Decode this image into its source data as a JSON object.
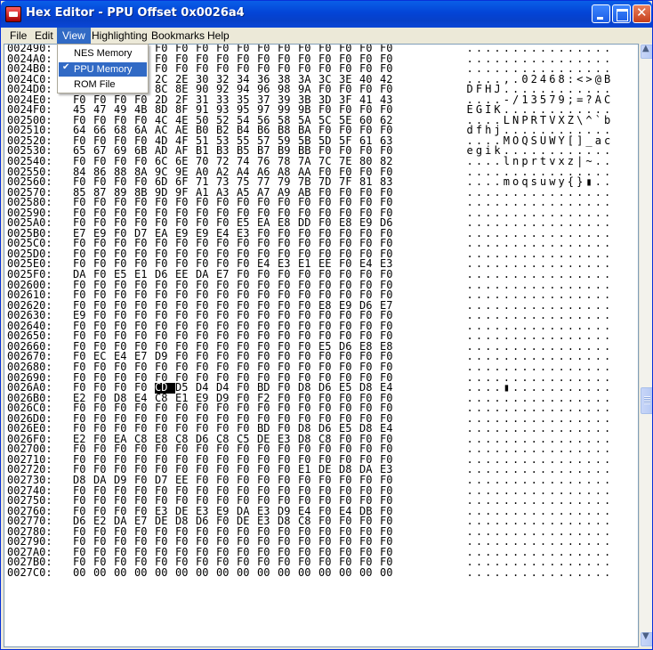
{
  "window": {
    "title": "Hex Editor - PPU Offset 0x0026a4"
  },
  "menubar": {
    "items": [
      "File",
      "Edit",
      "View",
      "Highlighting",
      "Bookmarks",
      "Help"
    ],
    "active": "View"
  },
  "view_menu": {
    "items": [
      {
        "label": "NES Memory"
      },
      {
        "label": "PPU Memory",
        "checked": true
      },
      {
        "label": "ROM File"
      }
    ]
  },
  "hex": {
    "cursor_offset": "0026A4",
    "rows": [
      {
        "address": "002490",
        "bytes": "F0 F0 F0 F0 F0 F0 F0 F0 F0 F0 F0 F0 F0 F0 F0 F0",
        "ascii": "................"
      },
      {
        "address": "0024A0",
        "bytes": "F0 F0 F0 F0 F0 F0 F0 F0 F0 F0 F0 F0 F0 F0 F0 F0",
        "ascii": "................"
      },
      {
        "address": "0024B0",
        "bytes": "F0 F0 F0 F0 F0 F0 F0 F0 F0 F0 F0 F0 F0 F0 F0 F0",
        "ascii": "................"
      },
      {
        "address": "0024C0",
        "bytes": "F0 F0 F0 F0 2C 2E 30 32 34 36 38 3A 3C 3E 40 42",
        "ascii": "....,.02468:<>@B"
      },
      {
        "address": "0024D0",
        "bytes": "44 46 48 4A 8C 8E 90 92 94 96 98 9A F0 F0 F0 F0",
        "ascii": "DFHJ............"
      },
      {
        "address": "0024E0",
        "bytes": "F0 F0 F0 F0 2D 2F 31 33 35 37 39 3B 3D 3F 41 43",
        "ascii": "....-/13579;=?AC"
      },
      {
        "address": "0024F0",
        "bytes": "45 47 49 4B 8D 8F 91 93 95 97 99 9B F0 F0 F0 F0",
        "ascii": "EGIK............"
      },
      {
        "address": "002500",
        "bytes": "F0 F0 F0 F0 4C 4E 50 52 54 56 58 5A 5C 5E 60 62",
        "ascii": "....LNPRTVXZ\\^`b"
      },
      {
        "address": "002510",
        "bytes": "64 66 68 6A AC AE B0 B2 B4 B6 B8 BA F0 F0 F0 F0",
        "ascii": "dfhj............"
      },
      {
        "address": "002520",
        "bytes": "F0 F0 F0 F0 4D 4F 51 53 55 57 59 5B 5D 5F 61 63",
        "ascii": "....MOQSUWY[]_ac"
      },
      {
        "address": "002530",
        "bytes": "65 67 69 6B AD AF B1 B3 B5 B7 B9 BB F0 F0 F0 F0",
        "ascii": "egik............"
      },
      {
        "address": "002540",
        "bytes": "F0 F0 F0 F0 6C 6E 70 72 74 76 78 7A 7C 7E 80 82",
        "ascii": "....lnprtvxz|~.."
      },
      {
        "address": "002550",
        "bytes": "84 86 88 8A 9C 9E A0 A2 A4 A6 A8 AA F0 F0 F0 F0",
        "ascii": "................"
      },
      {
        "address": "002560",
        "bytes": "F0 F0 F0 F0 6D 6F 71 73 75 77 79 7B 7D 7F 81 83",
        "ascii": "....moqsuwy{}▮.."
      },
      {
        "address": "002570",
        "bytes": "85 87 89 8B 9D 9F A1 A3 A5 A7 A9 AB F0 F0 F0 F0",
        "ascii": "................"
      },
      {
        "address": "002580",
        "bytes": "F0 F0 F0 F0 F0 F0 F0 F0 F0 F0 F0 F0 F0 F0 F0 F0",
        "ascii": "................"
      },
      {
        "address": "002590",
        "bytes": "F0 F0 F0 F0 F0 F0 F0 F0 F0 F0 F0 F0 F0 F0 F0 F0",
        "ascii": "................"
      },
      {
        "address": "0025A0",
        "bytes": "F0 F0 F0 F0 F0 F0 F0 F0 E5 EA E8 DD F0 E8 E9 D6",
        "ascii": "................"
      },
      {
        "address": "0025B0",
        "bytes": "E7 E9 F0 D7 EA E9 E9 E4 E3 F0 F0 F0 F0 F0 F0 F0",
        "ascii": "................"
      },
      {
        "address": "0025C0",
        "bytes": "F0 F0 F0 F0 F0 F0 F0 F0 F0 F0 F0 F0 F0 F0 F0 F0",
        "ascii": "................"
      },
      {
        "address": "0025D0",
        "bytes": "F0 F0 F0 F0 F0 F0 F0 F0 F0 F0 F0 F0 F0 F0 F0 F0",
        "ascii": "................"
      },
      {
        "address": "0025E0",
        "bytes": "F0 F0 F0 F0 F0 F0 F0 F0 F0 E4 E3 E1 EE F0 E4 E3",
        "ascii": "................"
      },
      {
        "address": "0025F0",
        "bytes": "DA F0 E5 E1 D6 EE DA E7 F0 F0 F0 F0 F0 F0 F0 F0",
        "ascii": "................"
      },
      {
        "address": "002600",
        "bytes": "F0 F0 F0 F0 F0 F0 F0 F0 F0 F0 F0 F0 F0 F0 F0 F0",
        "ascii": "................"
      },
      {
        "address": "002610",
        "bytes": "F0 F0 F0 F0 F0 F0 F0 F0 F0 F0 F0 F0 F0 F0 F0 F0",
        "ascii": "................"
      },
      {
        "address": "002620",
        "bytes": "F0 F0 F0 F0 F0 F0 F0 F0 F0 F0 F0 F0 E8 E9 D6 E7",
        "ascii": "................"
      },
      {
        "address": "002630",
        "bytes": "E9 F0 F0 F0 F0 F0 F0 F0 F0 F0 F0 F0 F0 F0 F0 F0",
        "ascii": "................"
      },
      {
        "address": "002640",
        "bytes": "F0 F0 F0 F0 F0 F0 F0 F0 F0 F0 F0 F0 F0 F0 F0 F0",
        "ascii": "................"
      },
      {
        "address": "002650",
        "bytes": "F0 F0 F0 F0 F0 F0 F0 F0 F0 F0 F0 F0 F0 F0 F0 F0",
        "ascii": "................"
      },
      {
        "address": "002660",
        "bytes": "F0 F0 F0 F0 F0 F0 F0 F0 F0 F0 F0 F0 E5 D6 E8 E8",
        "ascii": "................"
      },
      {
        "address": "002670",
        "bytes": "F0 EC E4 E7 D9 F0 F0 F0 F0 F0 F0 F0 F0 F0 F0 F0",
        "ascii": "................"
      },
      {
        "address": "002680",
        "bytes": "F0 F0 F0 F0 F0 F0 F0 F0 F0 F0 F0 F0 F0 F0 F0 F0",
        "ascii": "................"
      },
      {
        "address": "002690",
        "bytes": "F0 F0 F0 F0 F0 F0 F0 F0 F0 F0 F0 F0 F0 F0 F0 F0",
        "ascii": "................"
      },
      {
        "address": "0026A0",
        "bytes": "F0 F0 F0 F0 CD D5 D4 D4 F0 BD F0 D8 D6 E5 D8 E4",
        "ascii": "....▮..........."
      },
      {
        "address": "0026B0",
        "bytes": "E2 F0 D8 E4 C8 E1 E9 D9 F0 F2 F0 F0 F0 F0 F0 F0",
        "ascii": "................"
      },
      {
        "address": "0026C0",
        "bytes": "F0 F0 F0 F0 F0 F0 F0 F0 F0 F0 F0 F0 F0 F0 F0 F0",
        "ascii": "................"
      },
      {
        "address": "0026D0",
        "bytes": "F0 F0 F0 F0 F0 F0 F0 F0 F0 F0 F0 F0 F0 F0 F0 F0",
        "ascii": "................"
      },
      {
        "address": "0026E0",
        "bytes": "F0 F0 F0 F0 F0 F0 F0 F0 F0 BD F0 D8 D6 E5 D8 E4",
        "ascii": "................"
      },
      {
        "address": "0026F0",
        "bytes": "E2 F0 EA C8 E8 C8 D6 C8 C5 DE E3 D8 C8 F0 F0 F0",
        "ascii": "................"
      },
      {
        "address": "002700",
        "bytes": "F0 F0 F0 F0 F0 F0 F0 F0 F0 F0 F0 F0 F0 F0 F0 F0",
        "ascii": "................"
      },
      {
        "address": "002710",
        "bytes": "F0 F0 F0 F0 F0 F0 F0 F0 F0 F0 F0 F0 F0 F0 F0 F0",
        "ascii": "................"
      },
      {
        "address": "002720",
        "bytes": "F0 F0 F0 F0 F0 F0 F0 F0 F0 F0 F0 E1 DE D8 DA E3",
        "ascii": "................"
      },
      {
        "address": "002730",
        "bytes": "D8 DA D9 F0 D7 EE F0 F0 F0 F0 F0 F0 F0 F0 F0 F0",
        "ascii": "................"
      },
      {
        "address": "002740",
        "bytes": "F0 F0 F0 F0 F0 F0 F0 F0 F0 F0 F0 F0 F0 F0 F0 F0",
        "ascii": "................"
      },
      {
        "address": "002750",
        "bytes": "F0 F0 F0 F0 F0 F0 F0 F0 F0 F0 F0 F0 F0 F0 F0 F0",
        "ascii": "................"
      },
      {
        "address": "002760",
        "bytes": "F0 F0 F0 F0 E3 DE E3 E9 DA E3 D9 E4 F0 E4 DB F0",
        "ascii": "................"
      },
      {
        "address": "002770",
        "bytes": "D6 E2 DA E7 DE D8 D6 F0 DE E3 D8 C8 F0 F0 F0 F0",
        "ascii": "................"
      },
      {
        "address": "002780",
        "bytes": "F0 F0 F0 F0 F0 F0 F0 F0 F0 F0 F0 F0 F0 F0 F0 F0",
        "ascii": "................"
      },
      {
        "address": "002790",
        "bytes": "F0 F0 F0 F0 F0 F0 F0 F0 F0 F0 F0 F0 F0 F0 F0 F0",
        "ascii": "................"
      },
      {
        "address": "0027A0",
        "bytes": "F0 F0 F0 F0 F0 F0 F0 F0 F0 F0 F0 F0 F0 F0 F0 F0",
        "ascii": "................"
      },
      {
        "address": "0027B0",
        "bytes": "F0 F0 F0 F0 F0 F0 F0 F0 F0 F0 F0 F0 F0 F0 F0 F0",
        "ascii": "................"
      },
      {
        "address": "0027C0",
        "bytes": "00 00 00 00 00 00 00 00 00 00 00 00 00 00 00 00",
        "ascii": "................"
      }
    ]
  },
  "colors": {
    "titlebar": "#0A58E0",
    "menu_highlight": "#316AC5",
    "cursor": "#000000"
  }
}
